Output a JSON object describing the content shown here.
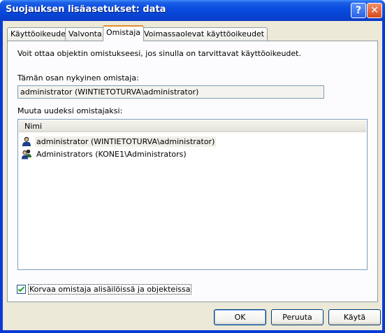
{
  "window": {
    "title": "Suojauksen lisäasetukset: data",
    "help_glyph": "?",
    "close_glyph": "✕"
  },
  "tabs": [
    {
      "label": "Käyttöoikeudet",
      "active": false
    },
    {
      "label": "Valvonta",
      "active": false
    },
    {
      "label": "Omistaja",
      "active": true
    },
    {
      "label": "Voimassaolevat käyttöoikeudet",
      "active": false
    }
  ],
  "owner_tab": {
    "intro": "Voit ottaa objektin omistukseesi, jos sinulla on tarvittavat käyttöoikeudet.",
    "current_owner_label": "Tämän osan nykyinen omistaja:",
    "current_owner_value": "administrator (WINTIETOTURVA\\administrator)",
    "change_owner_label": "Muuta uudeksi omistajaksi:",
    "list_header": "Nimi",
    "list_items": [
      {
        "label": "administrator (WINTIETOTURVA\\administrator)",
        "icon": "user-icon",
        "selected": true
      },
      {
        "label": "Administrators (KONE1\\Administrators)",
        "icon": "group-icon",
        "selected": false
      }
    ],
    "replace_owner_checkbox": {
      "label": "Korvaa omistaja alisäilöissä ja objekteissa",
      "checked": true
    }
  },
  "buttons": {
    "ok": "OK",
    "cancel": "Peruuta",
    "apply": "Käytä"
  }
}
